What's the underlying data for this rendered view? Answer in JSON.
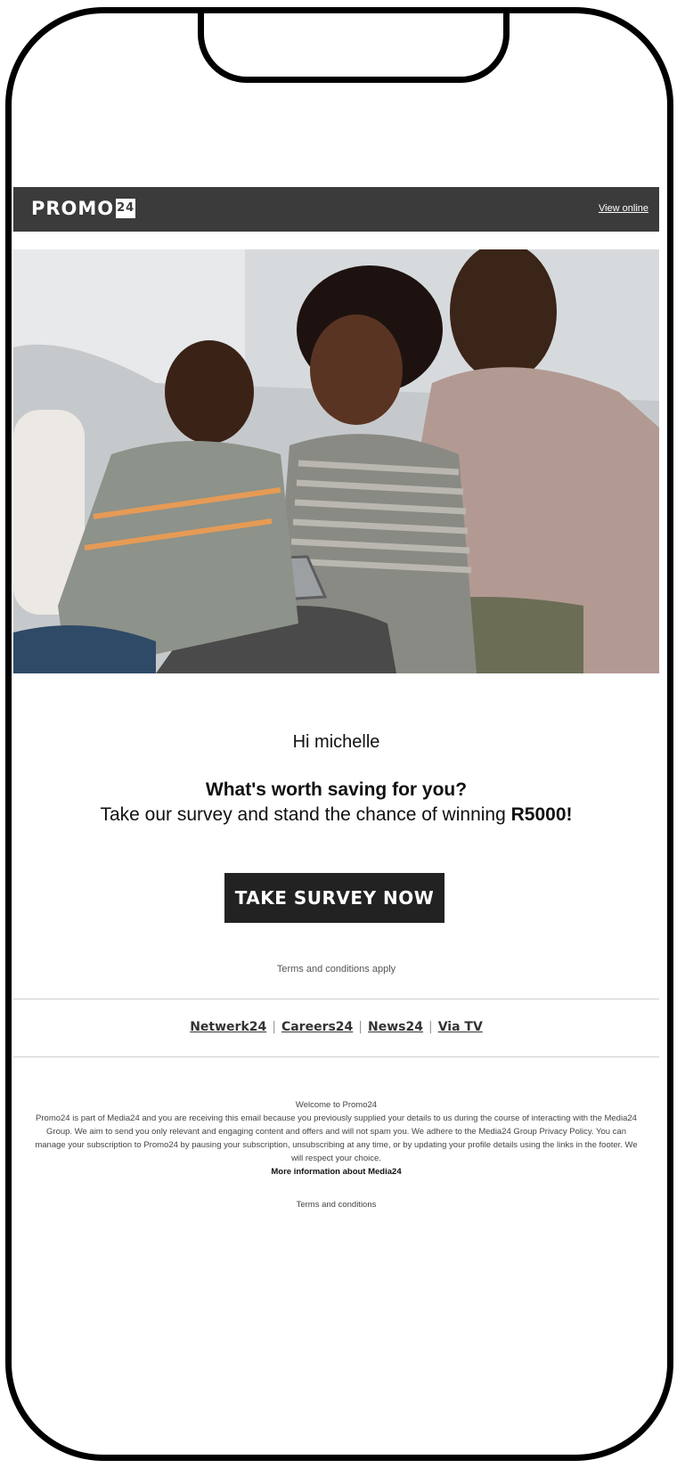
{
  "header": {
    "logo_text": "PROMO",
    "logo_badge": "24",
    "view_online": "View online"
  },
  "hero": {
    "image": "family-on-couch-with-tablet"
  },
  "content": {
    "greeting": "Hi michelle",
    "headline": "What's worth saving for you?",
    "subline_prefix": "Take our survey and stand the chance of winning ",
    "subline_amount": "R5000!",
    "cta_label": "TAKE SURVEY NOW",
    "terms": "Terms and conditions apply"
  },
  "links": [
    {
      "label": "Netwerk24"
    },
    {
      "label": "Careers24"
    },
    {
      "label": "News24"
    },
    {
      "label": "Via TV"
    }
  ],
  "footer": {
    "title": "Welcome to Promo24",
    "body": "Promo24 is part of Media24 and you are receiving this email because you previously supplied your details to us during the course of interacting with the Media24 Group. We aim to send you only relevant and engaging content and offers and will not spam you. We adhere to the Media24 Group Privacy Policy. You can manage your subscription to Promo24 by pausing your subscription, unsubscribing at any time, or by updating your profile details using the links in the footer. We will respect your choice.",
    "more_info": "More information about Media24",
    "terms_link": "Terms and conditions"
  },
  "colors": {
    "header_bg": "#3b3b3b",
    "cta_bg": "#222222",
    "frame": "#000000"
  }
}
